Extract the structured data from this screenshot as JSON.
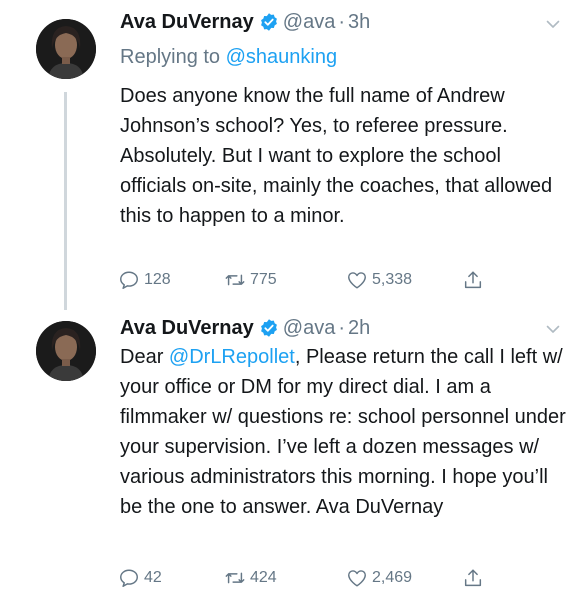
{
  "tweets": [
    {
      "author": "Ava DuVernay",
      "handle": "@ava",
      "separator": "·",
      "time": "3h",
      "replying_prefix": "Replying to ",
      "replying_to": "@shaunking",
      "text": "Does anyone know the full name of Andrew Johnson’s school? Yes, to referee pressure. Absolutely. But I want to explore the school officials on-site, mainly the coaches, that allowed this to happen to a minor.",
      "replies": "128",
      "retweets": "775",
      "likes": "5,338"
    },
    {
      "author": "Ava DuVernay",
      "handle": "@ava",
      "separator": "·",
      "time": "2h",
      "text_prefix": "Dear ",
      "mention": "@DrLRepollet",
      "text_rest": ", Please return the call I left w/ your office or DM for my direct dial. I am a filmmaker w/ questions re: school personnel under your supervision. I’ve left a dozen messages w/ various administrators this morning. I hope you’ll be the one to answer. Ava DuVernay",
      "replies": "42",
      "retweets": "424",
      "likes": "2,469"
    }
  ],
  "icons": {
    "verified": "verified-badge-icon",
    "menu": "chevron-down-icon",
    "reply": "reply-icon",
    "retweet": "retweet-icon",
    "like": "heart-icon",
    "share": "share-icon"
  },
  "colors": {
    "text": "#14171a",
    "secondary": "#657786",
    "link": "#1da1f2",
    "thread_line": "#d0d7dc"
  }
}
